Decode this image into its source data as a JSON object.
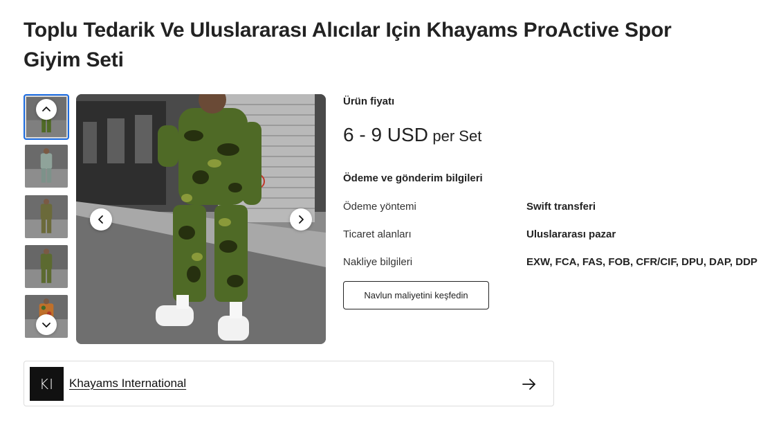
{
  "product": {
    "title": "Toplu Tedarik Ve Uluslararası Alıcılar Için Khayams ProActive Spor Giyim Seti"
  },
  "gallery": {
    "thumbnail_count": 5,
    "active_index": 0,
    "thumb_up_icon": "chevron-up-icon",
    "thumb_down_icon": "chevron-down-icon",
    "prev_icon": "chevron-left-icon",
    "next_icon": "chevron-right-icon",
    "active_border_color": "#1a6ae0"
  },
  "pricing": {
    "label": "Ürün fiyatı",
    "range": "6 - 9 USD",
    "unit": "per Set"
  },
  "payment_shipping": {
    "title": "Ödeme ve gönderim bilgileri",
    "rows": [
      {
        "key": "Ödeme yöntemi",
        "value": "Swift transferi"
      },
      {
        "key": "Ticaret alanları",
        "value": "Uluslararası pazar"
      },
      {
        "key": "Nakliye bilgileri",
        "value": "EXW, FCA, FAS, FOB, CFR/CIF, DPU, DAP, DDP"
      }
    ],
    "button_label": "Navlun maliyetini keşfedin"
  },
  "supplier": {
    "logo_text": "KI",
    "name": "Khayams International",
    "arrow_icon": "arrow-right-icon"
  }
}
